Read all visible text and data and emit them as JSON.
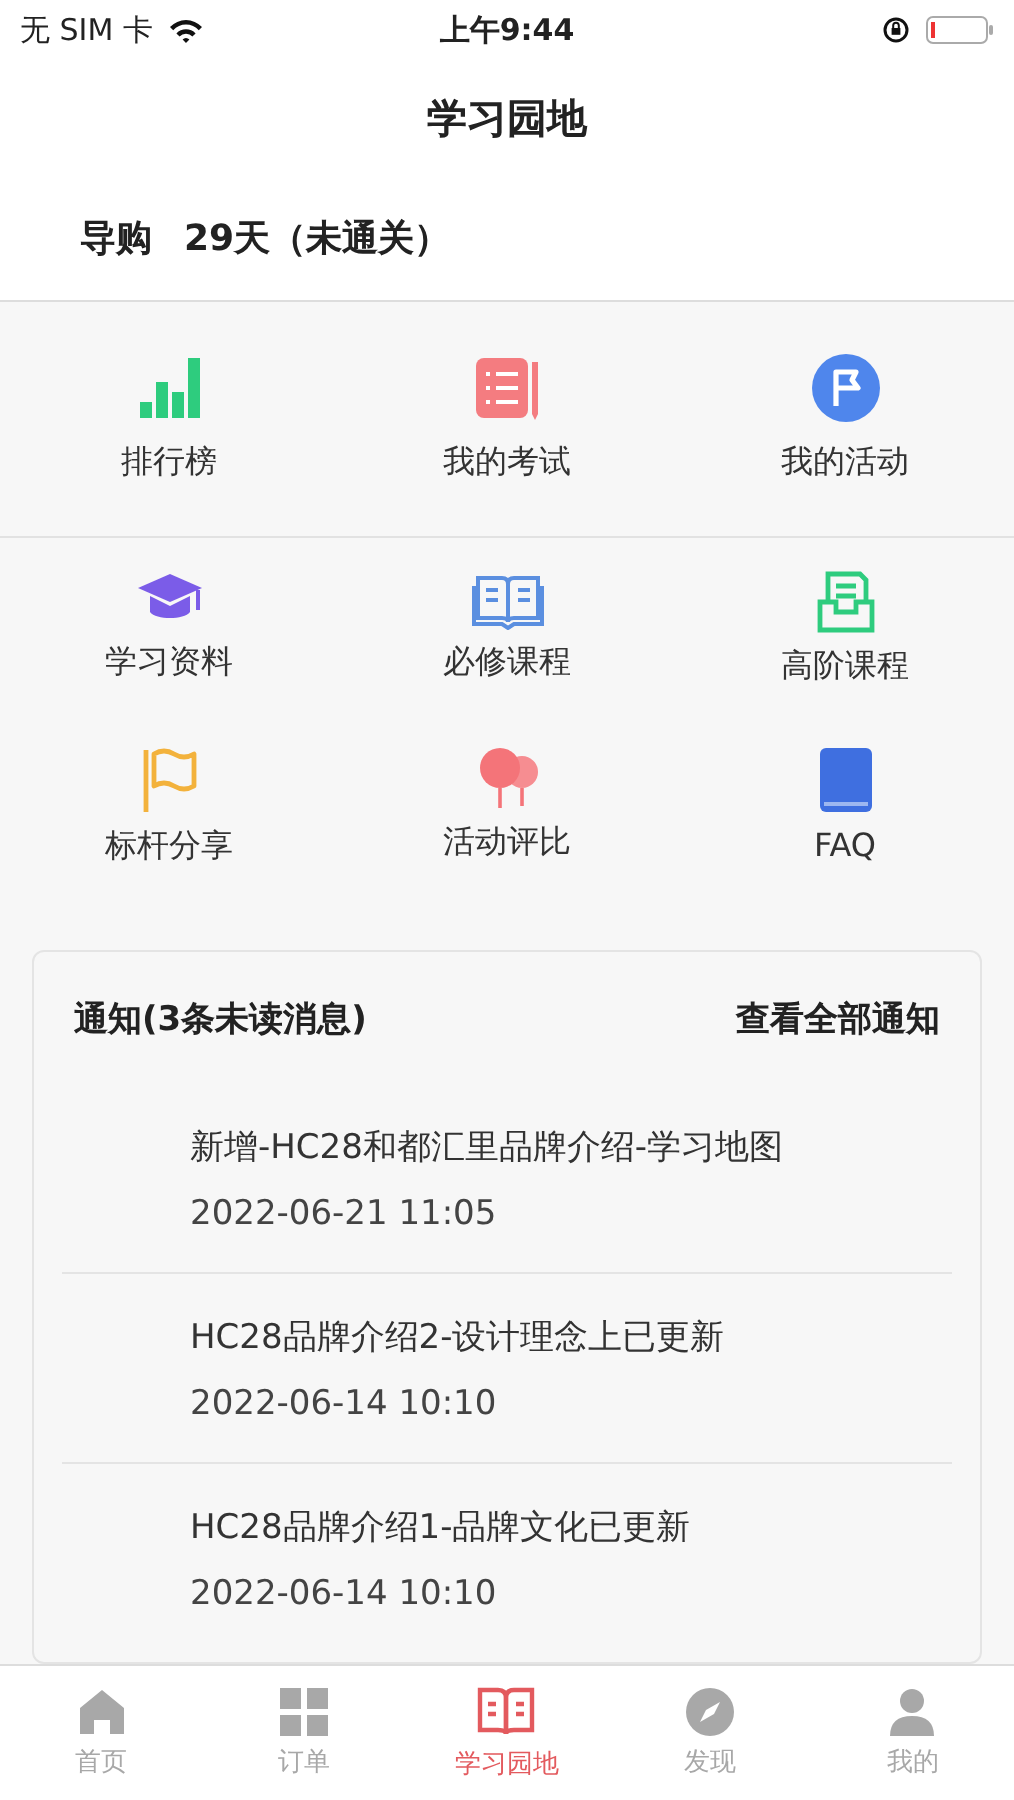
{
  "status_bar": {
    "carrier": "无 SIM 卡",
    "time": "上午9:44"
  },
  "nav": {
    "title": "学习园地"
  },
  "profile": {
    "role": "导购",
    "days": "29天（未通关）"
  },
  "top_menu": [
    {
      "label": "排行榜"
    },
    {
      "label": "我的考试"
    },
    {
      "label": "我的活动"
    }
  ],
  "grid_menu": [
    {
      "label": "学习资料"
    },
    {
      "label": "必修课程"
    },
    {
      "label": "高阶课程"
    },
    {
      "label": "标杆分享"
    },
    {
      "label": "活动评比"
    },
    {
      "label": "FAQ"
    }
  ],
  "notices": {
    "title": "通知(3条未读消息)",
    "view_all": "查看全部通知",
    "items": [
      {
        "title": "新增-HC28和都汇里品牌介绍-学习地图",
        "time": "2022-06-21 11:05"
      },
      {
        "title": "HC28品牌介绍2-设计理念上已更新",
        "time": "2022-06-14 10:10"
      },
      {
        "title": "HC28品牌介绍1-品牌文化已更新",
        "time": "2022-06-14 10:10"
      }
    ]
  },
  "tab_bar": [
    {
      "label": "首页",
      "selected": false
    },
    {
      "label": "订单",
      "selected": false
    },
    {
      "label": "学习园地",
      "selected": true
    },
    {
      "label": "发现",
      "selected": false
    },
    {
      "label": "我的",
      "selected": false
    }
  ]
}
